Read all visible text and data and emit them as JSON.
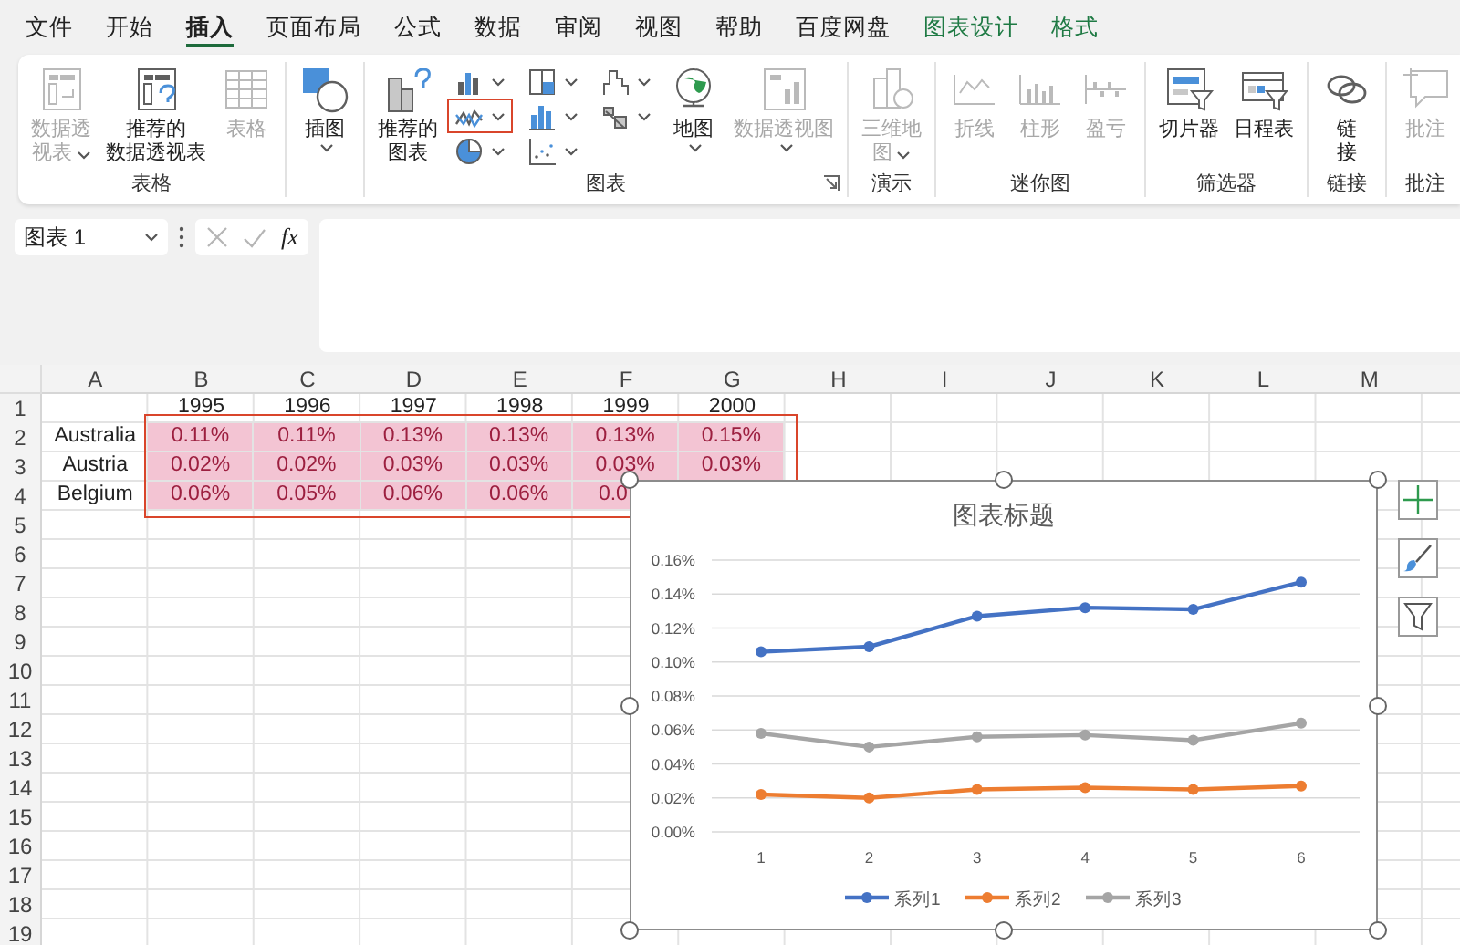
{
  "menu_tabs": [
    {
      "label": "文件",
      "kind": "normal",
      "selected": false
    },
    {
      "label": "开始",
      "kind": "normal",
      "selected": false
    },
    {
      "label": "插入",
      "kind": "normal",
      "selected": true
    },
    {
      "label": "页面布局",
      "kind": "normal",
      "selected": false
    },
    {
      "label": "公式",
      "kind": "normal",
      "selected": false
    },
    {
      "label": "数据",
      "kind": "normal",
      "selected": false
    },
    {
      "label": "审阅",
      "kind": "normal",
      "selected": false
    },
    {
      "label": "视图",
      "kind": "normal",
      "selected": false
    },
    {
      "label": "帮助",
      "kind": "normal",
      "selected": false
    },
    {
      "label": "百度网盘",
      "kind": "normal",
      "selected": false
    },
    {
      "label": "图表设计",
      "kind": "contextual",
      "selected": false
    },
    {
      "label": "格式",
      "kind": "contextual",
      "selected": false
    }
  ],
  "ribbon": {
    "groups": [
      {
        "label": "表格",
        "items": [
          {
            "kind": "large_inline_dropdown",
            "lines": [
              "数据透",
              "视表"
            ],
            "disabled": true
          },
          {
            "kind": "large",
            "lines": [
              "推荐的",
              "数据透视表"
            ],
            "disabled": false
          },
          {
            "kind": "large",
            "lines": [
              "表格"
            ],
            "disabled": true
          }
        ]
      },
      {
        "items": [
          {
            "kind": "large_dropdown",
            "lines": [
              "插图"
            ],
            "disabled": false
          }
        ]
      },
      {
        "label": "图表",
        "launcher": true,
        "items": [
          {
            "kind": "large",
            "lines": [
              "推荐的",
              "图表"
            ],
            "disabled": false
          },
          {
            "kind": "grid",
            "cells": [
              {
                "highlighted": false
              },
              {
                "highlighted": true
              },
              {
                "highlighted": false
              },
              {
                "highlighted": false
              },
              {
                "highlighted": false
              },
              {
                "highlighted": false
              },
              {
                "highlighted": false
              },
              {
                "highlighted": false
              }
            ]
          },
          {
            "kind": "large_dropdown",
            "lines": [
              "地图"
            ],
            "disabled": false
          },
          {
            "kind": "large_dropdown",
            "lines": [
              "数据透视图"
            ],
            "disabled": true
          }
        ]
      },
      {
        "label": "演示",
        "items": [
          {
            "kind": "large_inline_dropdown",
            "lines": [
              "三维地",
              "图"
            ],
            "disabled": true
          }
        ]
      },
      {
        "label": "迷你图",
        "items": [
          {
            "kind": "large",
            "lines": [
              "折线"
            ],
            "disabled": true
          },
          {
            "kind": "large",
            "lines": [
              "柱形"
            ],
            "disabled": true
          },
          {
            "kind": "large",
            "lines": [
              "盈亏"
            ],
            "disabled": true
          }
        ]
      },
      {
        "label": "筛选器",
        "items": [
          {
            "kind": "large",
            "lines": [
              "切片器"
            ],
            "disabled": false
          },
          {
            "kind": "large",
            "lines": [
              "日程表"
            ],
            "disabled": false
          }
        ]
      },
      {
        "label": "链接",
        "items": [
          {
            "kind": "large",
            "lines": [
              "链",
              "接"
            ],
            "disabled": false
          }
        ]
      },
      {
        "label": "批注",
        "items": [
          {
            "kind": "large",
            "lines": [
              "批注"
            ],
            "disabled": true
          }
        ]
      }
    ]
  },
  "formula_bar": {
    "name_box": "图表 1",
    "function_label": "fx"
  },
  "sheet": {
    "columns": [
      "A",
      "B",
      "C",
      "D",
      "E",
      "F",
      "G",
      "H",
      "I",
      "J",
      "K",
      "L",
      "M"
    ],
    "highlight_frame": true,
    "rows": [
      {
        "number": "1",
        "cells": [
          null,
          {
            "text": "1995",
            "highlighted": false
          },
          {
            "text": "1996",
            "highlighted": false
          },
          {
            "text": "1997",
            "highlighted": false
          },
          {
            "text": "1998",
            "highlighted": false
          },
          {
            "text": "1999",
            "highlighted": false
          },
          {
            "text": "2000",
            "highlighted": false
          }
        ]
      },
      {
        "number": "2",
        "cells": [
          {
            "text": "Australia",
            "highlighted": false
          },
          {
            "text": "0.11%",
            "highlighted": true
          },
          {
            "text": "0.11%",
            "highlighted": true
          },
          {
            "text": "0.13%",
            "highlighted": true
          },
          {
            "text": "0.13%",
            "highlighted": true
          },
          {
            "text": "0.13%",
            "highlighted": true
          },
          {
            "text": "0.15%",
            "highlighted": true
          }
        ]
      },
      {
        "number": "3",
        "cells": [
          {
            "text": "Austria",
            "highlighted": false
          },
          {
            "text": "0.02%",
            "highlighted": true
          },
          {
            "text": "0.02%",
            "highlighted": true
          },
          {
            "text": "0.03%",
            "highlighted": true
          },
          {
            "text": "0.03%",
            "highlighted": true
          },
          {
            "text": "0.03%",
            "highlighted": true
          },
          {
            "text": "0.03%",
            "highlighted": true
          }
        ]
      },
      {
        "number": "4",
        "cells": [
          {
            "text": "Belgium",
            "highlighted": false
          },
          {
            "text": "0.06%",
            "highlighted": true
          },
          {
            "text": "0.05%",
            "highlighted": true
          },
          {
            "text": "0.06%",
            "highlighted": true
          },
          {
            "text": "0.06%",
            "highlighted": true
          },
          {
            "text": "0.0",
            "highlighted": true,
            "kind": "clipped"
          }
        ]
      },
      {
        "number": "5"
      },
      {
        "number": "6"
      },
      {
        "number": "7"
      },
      {
        "number": "8"
      },
      {
        "number": "9"
      },
      {
        "number": "10"
      },
      {
        "number": "11"
      },
      {
        "number": "12"
      },
      {
        "number": "13"
      },
      {
        "number": "14"
      },
      {
        "number": "15"
      },
      {
        "number": "16"
      },
      {
        "number": "17"
      },
      {
        "number": "18"
      },
      {
        "number": "19"
      }
    ],
    "chart": {
      "selected": true,
      "chart_data": {
        "type": "line",
        "title": "图表标题",
        "categories": [
          "1",
          "2",
          "3",
          "4",
          "5",
          "6"
        ],
        "series": [
          {
            "name": "系列1",
            "color": "#4472c4",
            "marker": "circle",
            "values": [
              0.106,
              0.109,
              0.127,
              0.132,
              0.131,
              0.147
            ]
          },
          {
            "name": "系列2",
            "color": "#ed7d31",
            "marker": "circle",
            "values": [
              0.022,
              0.02,
              0.025,
              0.026,
              0.025,
              0.027
            ]
          },
          {
            "name": "系列3",
            "color": "#a5a5a5",
            "marker": "circle",
            "values": [
              0.058,
              0.05,
              0.056,
              0.057,
              0.054,
              0.064
            ]
          }
        ],
        "grid": true,
        "legend": true,
        "ylim": [
          0,
          0.16
        ],
        "yticks": [
          {
            "value": 0,
            "label": "0.00%"
          },
          {
            "value": 0.02,
            "label": "0.02%"
          },
          {
            "value": 0.04,
            "label": "0.04%"
          },
          {
            "value": 0.06,
            "label": "0.06%"
          },
          {
            "value": 0.08,
            "label": "0.08%"
          },
          {
            "value": 0.1,
            "label": "0.10%"
          },
          {
            "value": 0.12,
            "label": "0.12%"
          },
          {
            "value": 0.14,
            "label": "0.14%"
          },
          {
            "value": 0.16,
            "label": "0.16%"
          }
        ]
      }
    }
  }
}
